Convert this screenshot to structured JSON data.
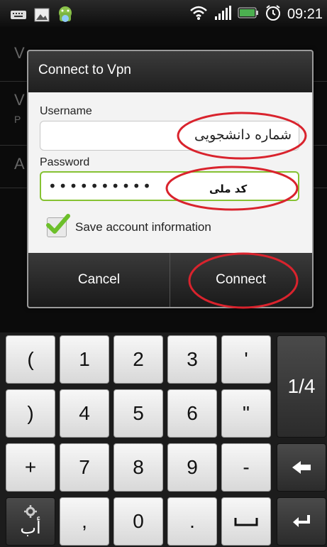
{
  "status_bar": {
    "time": "09:21",
    "left_icons": [
      "keyboard-icon",
      "image-icon",
      "android-icon"
    ],
    "right_icons": [
      "wifi-icon",
      "signal-icon",
      "battery-icon",
      "alarm-icon"
    ]
  },
  "background_activity": {
    "rows": [
      {
        "title": "V",
        "subtitle": ""
      },
      {
        "title": "V",
        "subtitle": "P"
      },
      {
        "title": "A",
        "subtitle": ""
      }
    ]
  },
  "dialog": {
    "title": "Connect to Vpn",
    "username_label": "Username",
    "username_annotation": "شماره دانشجویی",
    "password_label": "Password",
    "password_value": "••••••••••",
    "password_annotation": "کد ملی",
    "save_checkbox": {
      "label": "Save account information",
      "checked": true
    },
    "cancel_label": "Cancel",
    "connect_label": "Connect"
  },
  "annotation_color": "#d9232d",
  "accent_green": "#86c233",
  "keyboard": {
    "row1": [
      "(",
      "1",
      "2",
      "3",
      "'"
    ],
    "row2": [
      ")",
      "4",
      "5",
      "6",
      "\""
    ],
    "row3": [
      "+",
      "7",
      "8",
      "9",
      "-"
    ],
    "row4": [
      "أب",
      ",",
      "0",
      "."
    ],
    "page_key": "1/4",
    "backspace_icon": "backspace-icon",
    "enter_icon": "enter-icon",
    "space_icon": "space-icon",
    "settings_icon": "gear-icon"
  }
}
